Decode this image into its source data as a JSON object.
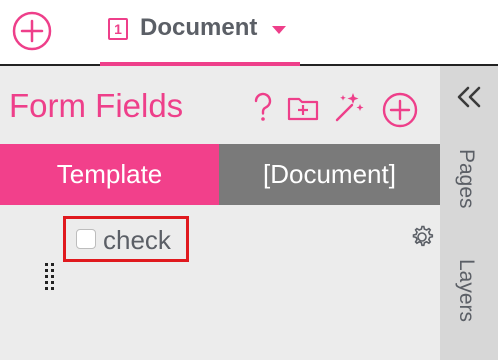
{
  "colors": {
    "accent": "#ee3f8a",
    "tab_active": "#f2408b",
    "tab_inactive": "#7a7a7a",
    "highlight": "#e0191e"
  },
  "topbar": {
    "add_document_icon": "plus-circle-icon",
    "document_tab": {
      "number": "1",
      "title": "Document",
      "dropdown_icon": "caret-down-icon"
    }
  },
  "panel": {
    "title": "Form Fields",
    "tools": [
      "help-icon",
      "add-folder-icon",
      "magic-wand-icon",
      "add-field-icon"
    ],
    "tabs": [
      {
        "label": "Template",
        "active": true
      },
      {
        "label": "[Document]",
        "active": false
      }
    ],
    "field": {
      "label": "check",
      "checked": false,
      "settings_icon": "gear-icon",
      "drag_icon": "drag-handle-icon"
    }
  },
  "sidebar": {
    "collapse_icon": "double-chevron-left-icon",
    "tabs": [
      "Pages",
      "Layers"
    ]
  }
}
